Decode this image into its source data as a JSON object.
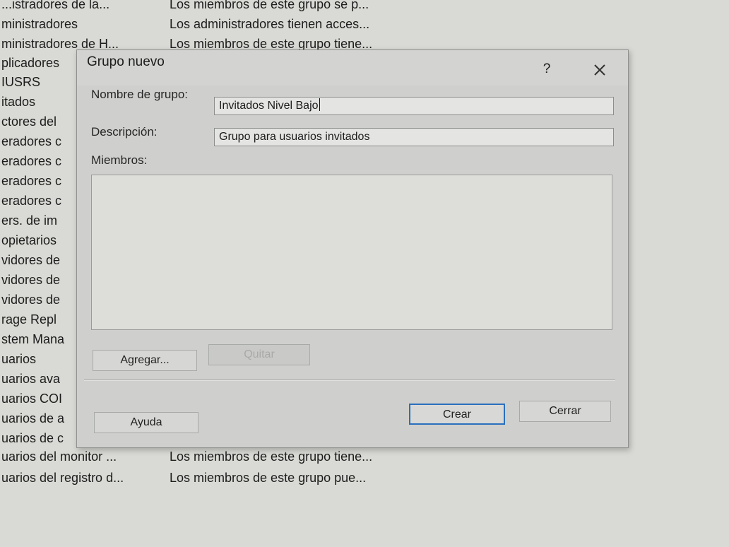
{
  "background_list": [
    {
      "name": "...istradores de la...",
      "description": "Los miembros de este grupo se p..."
    },
    {
      "name": "ministradores",
      "description": "Los administradores tienen acces..."
    },
    {
      "name": "ministradores de H...",
      "description": "Los miembros de este grupo tiene..."
    },
    {
      "name": "plicadores",
      "description": ""
    },
    {
      "name": "IUSRS",
      "description": ""
    },
    {
      "name": "itados",
      "description": ""
    },
    {
      "name": "ctores del",
      "description": ""
    },
    {
      "name": "eradores c",
      "description": ""
    },
    {
      "name": "eradores c",
      "description": ""
    },
    {
      "name": "eradores c",
      "description": ""
    },
    {
      "name": "eradores c",
      "description": ""
    },
    {
      "name": "ers. de im",
      "description": ""
    },
    {
      "name": "opietarios",
      "description": ""
    },
    {
      "name": "vidores de",
      "description": ""
    },
    {
      "name": "vidores de",
      "description": ""
    },
    {
      "name": "vidores de",
      "description": ""
    },
    {
      "name": "rage Repl",
      "description": ""
    },
    {
      "name": "stem Mana",
      "description": ""
    },
    {
      "name": "uarios",
      "description": ""
    },
    {
      "name": "uarios ava",
      "description": ""
    },
    {
      "name": "uarios COI",
      "description": ""
    },
    {
      "name": "uarios de a",
      "description": ""
    },
    {
      "name": "uarios de c",
      "description": ""
    },
    {
      "name": "uarios del monitor ...",
      "description": "Los miembros de este grupo tiene..."
    },
    {
      "name": "uarios del registro d...",
      "description": "Los miembros de este grupo pue..."
    }
  ],
  "dialog": {
    "title": "Grupo nuevo",
    "help_glyph": "?",
    "labels": {
      "group_name": "Nombre de grupo:",
      "description": "Descripción:",
      "members": "Miembros:"
    },
    "fields": {
      "group_name": "Invitados Nivel Bajo",
      "description": "Grupo para usuarios invitados"
    },
    "buttons": {
      "add": "Agregar...",
      "remove": "Quitar",
      "help": "Ayuda",
      "create": "Crear",
      "close": "Cerrar"
    },
    "accent_color": "#2a6fbe"
  }
}
